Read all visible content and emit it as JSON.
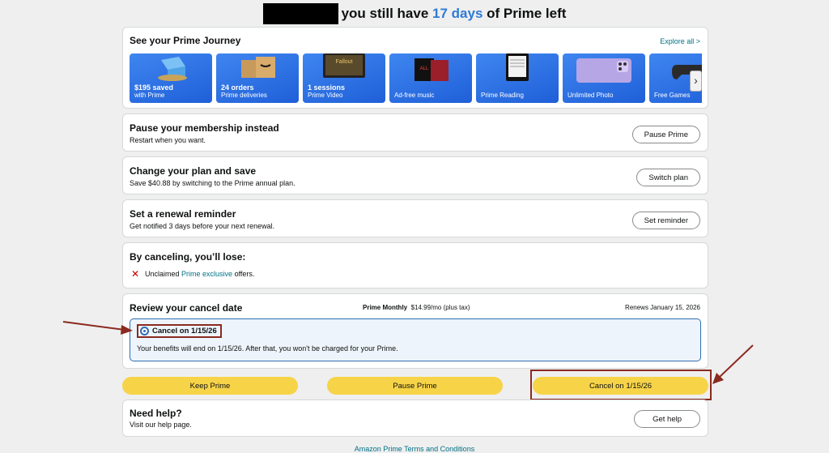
{
  "header": {
    "text_pre": "you still have ",
    "days": "17 days",
    "text_post": " of Prime left"
  },
  "journey": {
    "title": "See your Prime Journey",
    "explore": "Explore all >",
    "tiles": [
      {
        "bold": "$195 saved",
        "sub": "with Prime"
      },
      {
        "bold": "24 orders",
        "sub": "Prime deliveries"
      },
      {
        "bold": "1 sessions",
        "sub": "Prime Video"
      },
      {
        "bold": "",
        "sub": "Ad-free music"
      },
      {
        "bold": "",
        "sub": "Prime Reading"
      },
      {
        "bold": "",
        "sub": "Unlimited Photo"
      },
      {
        "bold": "",
        "sub": "Free Games"
      }
    ]
  },
  "pause_card": {
    "title": "Pause your membership instead",
    "sub": "Restart when you want.",
    "button": "Pause Prime"
  },
  "plan_card": {
    "title": "Change your plan and save",
    "sub": "Save $40.88 by switching to the Prime annual plan.",
    "button": "Switch plan"
  },
  "reminder_card": {
    "title": "Set a renewal reminder",
    "sub": "Get notified 3 days before your next renewal.",
    "button": "Set reminder"
  },
  "lose_card": {
    "title": "By canceling, you’ll lose:",
    "pre": "Unclaimed ",
    "link": "Prime exclusive",
    "post": " offers."
  },
  "review_card": {
    "title": "Review your cancel date",
    "plan_name": "Prime Monthly",
    "plan_price": "$14.99/mo (plus tax)",
    "renews": "Renews January 15, 2026",
    "option_label": "Cancel on 1/15/26",
    "option_desc": "Your benefits will end on 1/15/26. After that, you won't be charged for your Prime."
  },
  "actions": {
    "keep": "Keep Prime",
    "pause": "Pause Prime",
    "cancel": "Cancel on 1/15/26"
  },
  "help_card": {
    "title": "Need help?",
    "sub": "Visit our help page.",
    "button": "Get help"
  },
  "footer": {
    "link": "Amazon Prime Terms and Conditions"
  },
  "colors": {
    "accent": "#2e7bd6",
    "button_yellow": "#f7d348",
    "annotation": "#8b2a1f",
    "link": "#007185"
  }
}
